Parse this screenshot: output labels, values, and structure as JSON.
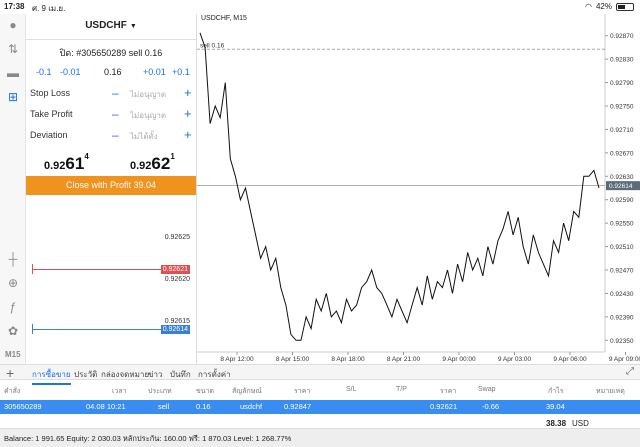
{
  "status": {
    "time": "17:38",
    "date": "ศ. 9 เม.ย.",
    "battery": "42%"
  },
  "sidebar": {
    "timeframe": "M15"
  },
  "panel": {
    "symbol": "USDCHF",
    "position_text": "ปิด: #305650289 sell 0.16",
    "volume_steps": [
      "-0.1",
      "-0.01",
      "0.16",
      "+0.01",
      "+0.1"
    ],
    "stop_loss": {
      "label": "Stop Loss",
      "value": "ไม่อนุญาต"
    },
    "take_profit": {
      "label": "Take Profit",
      "value": "ไม่อนุญาต"
    },
    "deviation": {
      "label": "Deviation",
      "value": "ไม่ได้ตั้ง"
    },
    "bid": {
      "a": "0.92",
      "b": "61",
      "c": "4"
    },
    "ask": {
      "a": "0.92",
      "b": "62",
      "c": "1"
    },
    "close_button": "Close with Profit 39.04",
    "depth_levels": [
      "0.92625",
      "0.92621",
      "0.92620",
      "0.92615",
      "0.92614"
    ]
  },
  "chart": {
    "title": "USDCHF, M15",
    "order_label": "sell 0.16",
    "current_price_tag": "0.92614"
  },
  "chart_data": {
    "type": "line",
    "title": "USDCHF, M15",
    "x_ticks": [
      "8 Apr 12:00",
      "8 Apr 15:00",
      "8 Apr 18:00",
      "8 Apr 21:00",
      "9 Apr 00:00",
      "9 Apr 03:00",
      "9 Apr 06:00",
      "9 Apr 09:00"
    ],
    "y_ticks": [
      "0.92870",
      "0.92830",
      "0.92790",
      "0.92750",
      "0.92710",
      "0.92670",
      "0.92630",
      "0.92590",
      "0.92550",
      "0.92510",
      "0.92470",
      "0.92430",
      "0.92390",
      "0.92350"
    ],
    "ylim": [
      0.9233,
      0.9289
    ],
    "order_level": 0.92847,
    "current": 0.92614,
    "values": [
      0.92875,
      0.9285,
      0.9272,
      0.9275,
      0.9273,
      0.9279,
      0.9266,
      0.9263,
      0.9259,
      0.9261,
      0.9257,
      0.9253,
      0.9249,
      0.9251,
      0.9247,
      0.9249,
      0.9244,
      0.9241,
      0.9236,
      0.9235,
      0.9235,
      0.9239,
      0.9237,
      0.9242,
      0.924,
      0.9243,
      0.9239,
      0.924,
      0.9238,
      0.9242,
      0.924,
      0.9241,
      0.9244,
      0.9245,
      0.9247,
      0.9244,
      0.9243,
      0.9241,
      0.9239,
      0.9242,
      0.924,
      0.9238,
      0.9241,
      0.9244,
      0.9241,
      0.9246,
      0.9242,
      0.9245,
      0.9244,
      0.9247,
      0.9243,
      0.9248,
      0.9245,
      0.925,
      0.9247,
      0.9249,
      0.9246,
      0.9251,
      0.9248,
      0.9252,
      0.9254,
      0.9257,
      0.9253,
      0.9256,
      0.9251,
      0.9248,
      0.9253,
      0.925,
      0.9248,
      0.9246,
      0.9252,
      0.925,
      0.9255,
      0.9252,
      0.9257,
      0.9256,
      0.9263,
      0.9263,
      0.9264,
      0.9261
    ]
  },
  "bottom_tabs": [
    "การซื้อขาย",
    "ประวัติ",
    "กล่องจดหมาย",
    "ข่าว",
    "บันทึก",
    "การตั้งค่า"
  ],
  "table": {
    "headers": [
      "คำสั่ง",
      "เวลา",
      "ประเภท",
      "ขนาด",
      "สัญลักษณ์",
      "ราคา",
      "S/L",
      "T/P",
      "ราคา",
      "Swap",
      "กำไร",
      "หมายเหตุ"
    ],
    "row": [
      "305650289",
      "04.08 10:21",
      "sell",
      "0.16",
      "usdchf",
      "0.92847",
      "",
      "",
      "0.92621",
      "-0.66",
      "39.04",
      ""
    ]
  },
  "profit_total": {
    "value": "38.38",
    "currency": "USD"
  },
  "balance_text": "Balance: 1 991.65 Equity: 2 030.03 หลักประกัน: 160.00 ฟรี: 1 870.03 Level: 1 268.77%",
  "colors": {
    "accent": "#1a73e8",
    "close": "#f0921e",
    "sell_line": "#e05050",
    "buy_line": "#3a7fd8"
  }
}
